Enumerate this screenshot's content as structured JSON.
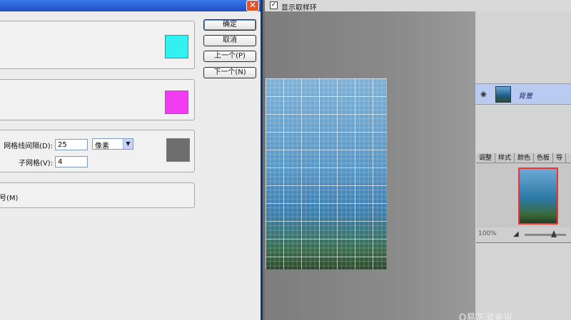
{
  "dialog": {
    "close_glyph": "✕",
    "gridline_label": "网格线间隔(D):",
    "gridline_value": "25",
    "unit": "像素",
    "subdivision_label": "子网格(V):",
    "subdivision_value": "4",
    "slice_numbers_label": "号(M)",
    "guides_color": "#33f1f1",
    "smart_guides_color": "#f13cf1",
    "grid_color": "#6e6e6e",
    "buttons": {
      "ok": "确定",
      "cancel": "取消",
      "prev": "上一个(P)",
      "next": "下一个(N)"
    }
  },
  "canvas": {
    "checkbox_label": "显示取样环",
    "checkbox_checked": "✓"
  },
  "layers": {
    "layer_name": "背景",
    "eye_icon": "eye-icon"
  },
  "navigator": {
    "tabs": [
      "调整",
      "样式",
      "颜色",
      "色板",
      "导"
    ],
    "zoom": "100%",
    "zoom_out_glyph": "◢"
  },
  "watermark": "Ο易下溜来说"
}
